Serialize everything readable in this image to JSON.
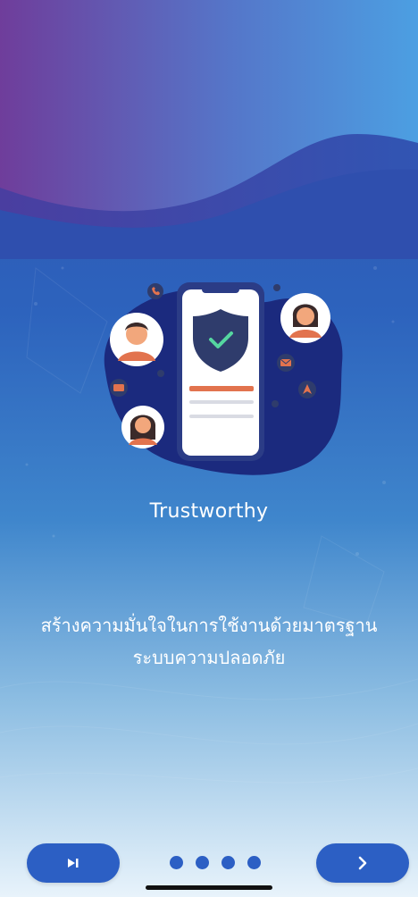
{
  "onboarding": {
    "title": "Trustworthy",
    "description": "สร้างความมั่นใจในการใช้งานด้วยมาตรฐาน ระบบความปลอดภัย",
    "current_page": 1,
    "total_pages": 4
  },
  "colors": {
    "header_gradient_start": "#7a3a98",
    "header_gradient_end": "#4a9ce0",
    "button_bg": "#2c5fc4",
    "blob": "#1b2a7e",
    "shield": "#2f3c6c",
    "accent_orange": "#e2734e"
  },
  "controls": {
    "skip_icon": "skip-to-end-icon",
    "next_icon": "chevron-right-icon"
  }
}
